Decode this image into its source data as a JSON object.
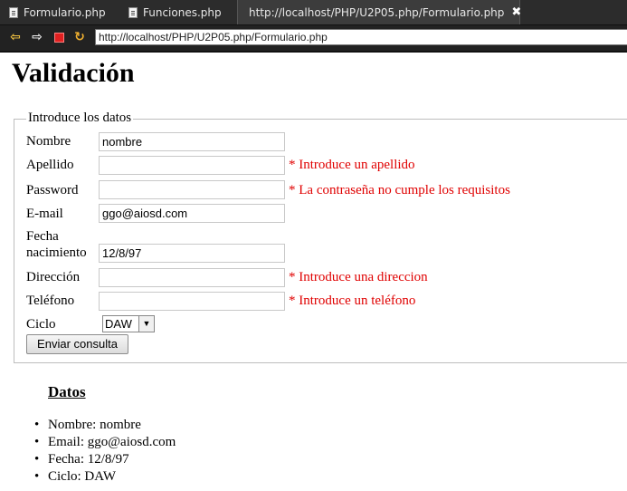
{
  "tabs": [
    {
      "label": "Formulario.php",
      "icon": "file-icon"
    },
    {
      "label": "Funciones.php",
      "icon": "file-icon"
    },
    {
      "label": "http://localhost/PHP/U2P05.php/Formulario.php",
      "icon": "globe-icon",
      "active": true
    }
  ],
  "toolbar": {
    "close_tab": "✖"
  },
  "address_bar": {
    "url": "http://localhost/PHP/U2P05.php/Formulario.php"
  },
  "page": {
    "title": "Validación",
    "fieldset": {
      "legend": "Introduce los datos",
      "fields": {
        "nombre": {
          "label": "Nombre",
          "value": "nombre"
        },
        "apellido": {
          "label": "Apellido",
          "value": "",
          "error": "* Introduce un apellido"
        },
        "password": {
          "label": "Password",
          "value": "",
          "error": "* La contraseña no cumple los requisitos"
        },
        "email": {
          "label": "E-mail",
          "value": "ggo@aiosd.com"
        },
        "fecha": {
          "label_line1": "Fecha",
          "label_line2": "nacimiento",
          "value": "12/8/97"
        },
        "direccion": {
          "label": "Dirección",
          "value": "",
          "error": "* Introduce una direccion"
        },
        "telefono": {
          "label": "Teléfono",
          "value": "",
          "error": "* Introduce un teléfono"
        },
        "ciclo": {
          "label": "Ciclo",
          "selected": "DAW"
        }
      },
      "submit_label": "Enviar consulta"
    },
    "datos": {
      "heading": "Datos",
      "items": [
        "Nombre: nombre",
        "Email: ggo@aiosd.com",
        "Fecha: 12/8/97",
        "Ciclo: DAW"
      ]
    }
  },
  "colors": {
    "error": "#e00000",
    "chrome_dark": "#2c2c2c"
  }
}
